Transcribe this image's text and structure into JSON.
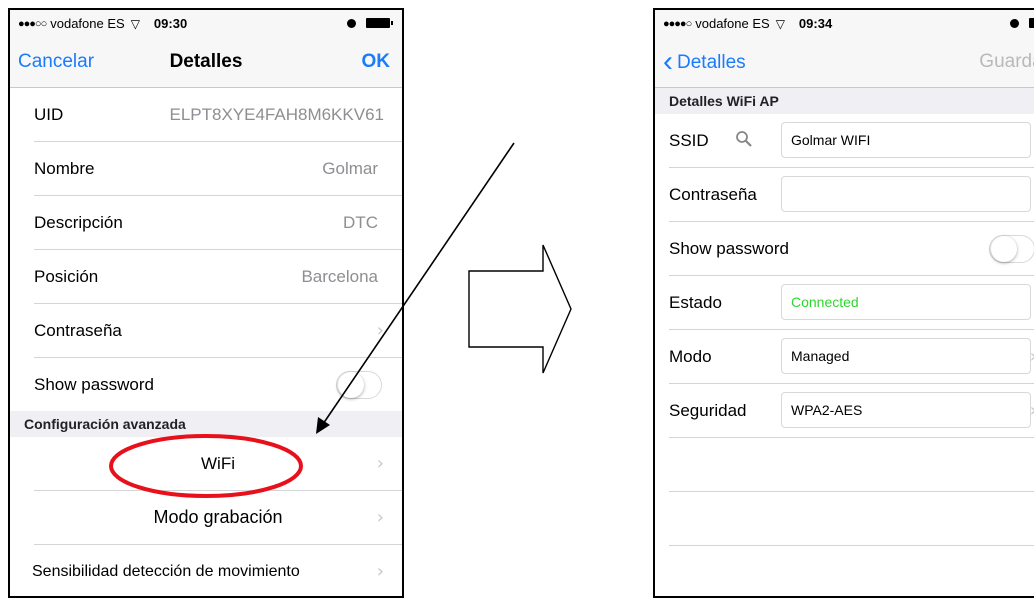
{
  "left": {
    "status": {
      "signal": "●●●○○",
      "carrier": "vodafone ES",
      "time": "09:30"
    },
    "nav": {
      "cancel": "Cancelar",
      "title": "Detalles",
      "ok": "OK"
    },
    "rows": {
      "uid": {
        "label": "UID",
        "value": "ELPT8XYE4FAH8M6KKV61"
      },
      "nombre": {
        "label": "Nombre",
        "value": "Golmar"
      },
      "descripcion": {
        "label": "Descripción",
        "value": "DTC"
      },
      "posicion": {
        "label": "Posición",
        "value": "Barcelona"
      },
      "contrasena": {
        "label": "Contraseña"
      },
      "show_password": {
        "label": "Show password"
      }
    },
    "section": "Configuración avanzada",
    "advanced": {
      "wifi": "WiFi",
      "modo": "Modo grabación",
      "sensibilidad": "Sensibilidad detección de movimiento"
    }
  },
  "right": {
    "status": {
      "signal": "●●●●○",
      "carrier": "vodafone ES",
      "time": "09:34"
    },
    "nav": {
      "back": "Detalles",
      "save": "Guardar"
    },
    "section": "Detalles WiFi AP",
    "ssid": {
      "label": "SSID",
      "value": "Golmar WIFI"
    },
    "contrasena": {
      "label": "Contraseña",
      "value": ""
    },
    "show_password": {
      "label": "Show password"
    },
    "estado": {
      "label": "Estado",
      "value": "Connected"
    },
    "modo": {
      "label": "Modo",
      "value": "Managed"
    },
    "seguridad": {
      "label": "Seguridad",
      "value": "WPA2-AES"
    }
  },
  "colors": {
    "accent": "#1a7bfb",
    "highlight": "#e8101b",
    "connected": "#2dd82d"
  },
  "icons": {
    "chevron": "›",
    "back": "‹"
  }
}
